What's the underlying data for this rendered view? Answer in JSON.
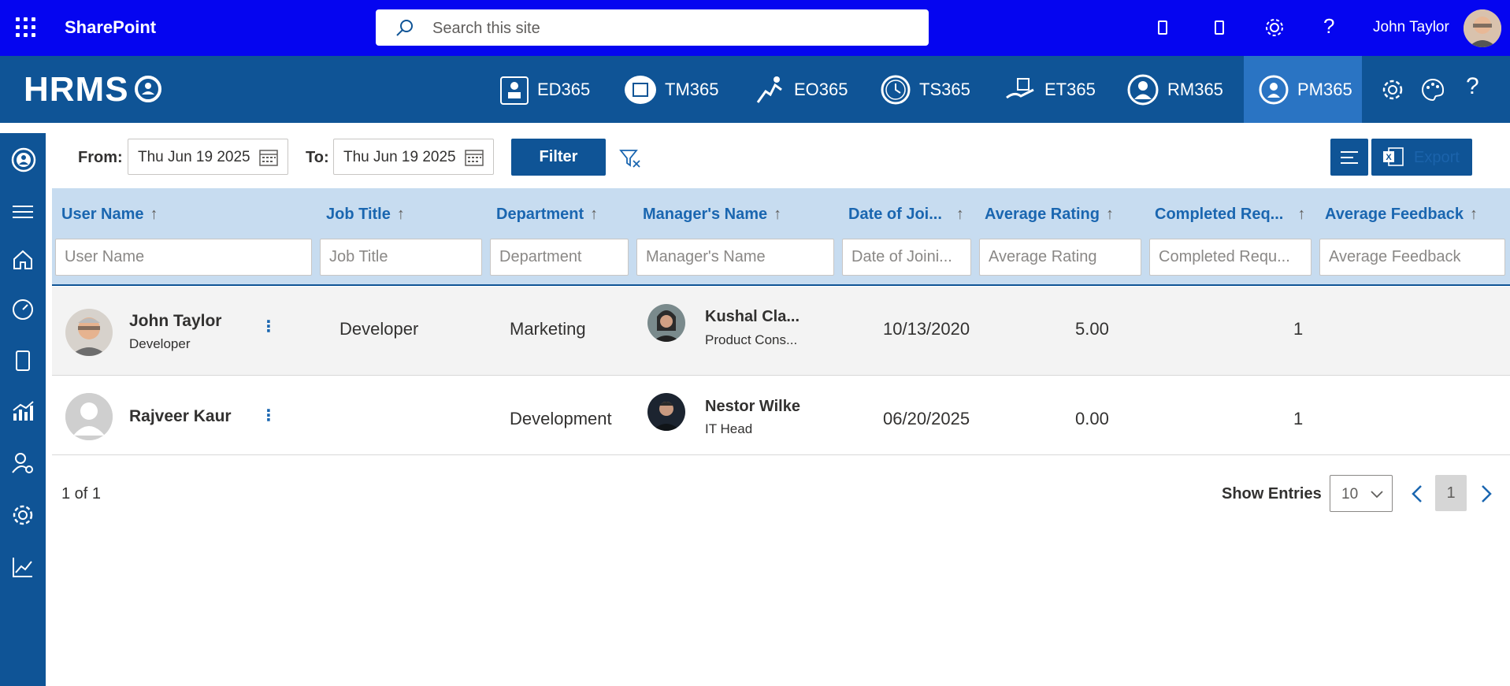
{
  "suitebar": {
    "app_name": "SharePoint",
    "search_placeholder": "Search this site",
    "user_name": "John Taylor"
  },
  "appbar": {
    "logo": "HRMS",
    "modules": [
      {
        "label": "ED365",
        "icon": "id-badge-icon"
      },
      {
        "label": "TM365",
        "icon": "calendar-bubble-icon"
      },
      {
        "label": "EO365",
        "icon": "running-person-icon"
      },
      {
        "label": "TS365",
        "icon": "clock-icon"
      },
      {
        "label": "ET365",
        "icon": "money-hand-icon"
      },
      {
        "label": "RM365",
        "icon": "person-circle-icon"
      },
      {
        "label": "PM365",
        "icon": "performance-icon",
        "active": true
      }
    ]
  },
  "filters": {
    "from_label": "From:",
    "from_value": "Thu Jun 19 2025",
    "to_label": "To:",
    "to_value": "Thu Jun 19 2025",
    "filter_button": "Filter",
    "export_label": "Export"
  },
  "table": {
    "columns": [
      {
        "label": "User Name",
        "placeholder": "User Name"
      },
      {
        "label": "Job Title",
        "placeholder": "Job Title"
      },
      {
        "label": "Department",
        "placeholder": "Department"
      },
      {
        "label": "Manager's Name",
        "placeholder": "Manager's Name"
      },
      {
        "label": "Date of Joi...",
        "placeholder": "Date of Joini..."
      },
      {
        "label": "Average Rating",
        "placeholder": "Average Rating"
      },
      {
        "label": "Completed Req...",
        "placeholder": "Completed Requ..."
      },
      {
        "label": "Average Feedback",
        "placeholder": "Average Feedback"
      }
    ],
    "sort_arrow": "↑",
    "rows": [
      {
        "user_name": "John Taylor",
        "user_subtitle": "Developer",
        "job_title": "Developer",
        "department": "Marketing",
        "manager_name": "Kushal Cla...",
        "manager_title": "Product Cons...",
        "date_of_joining": "10/13/2020",
        "average_rating": "5.00",
        "completed_requests": "1",
        "average_feedback": ""
      },
      {
        "user_name": "Rajveer Kaur",
        "user_subtitle": "",
        "job_title": "",
        "department": "Development",
        "manager_name": "Nestor Wilke",
        "manager_title": "IT Head",
        "date_of_joining": "06/20/2025",
        "average_rating": "0.00",
        "completed_requests": "1",
        "average_feedback": ""
      }
    ]
  },
  "pager": {
    "page_info": "1 of 1",
    "show_entries_label": "Show Entries",
    "entries_value": "10",
    "current_page": "1"
  },
  "colors": {
    "suitebar": "#0505f0",
    "appbar": "#0f5496",
    "active_module": "#2a74c3",
    "header_bg": "#c7dcf0",
    "header_text": "#1a66b0"
  }
}
